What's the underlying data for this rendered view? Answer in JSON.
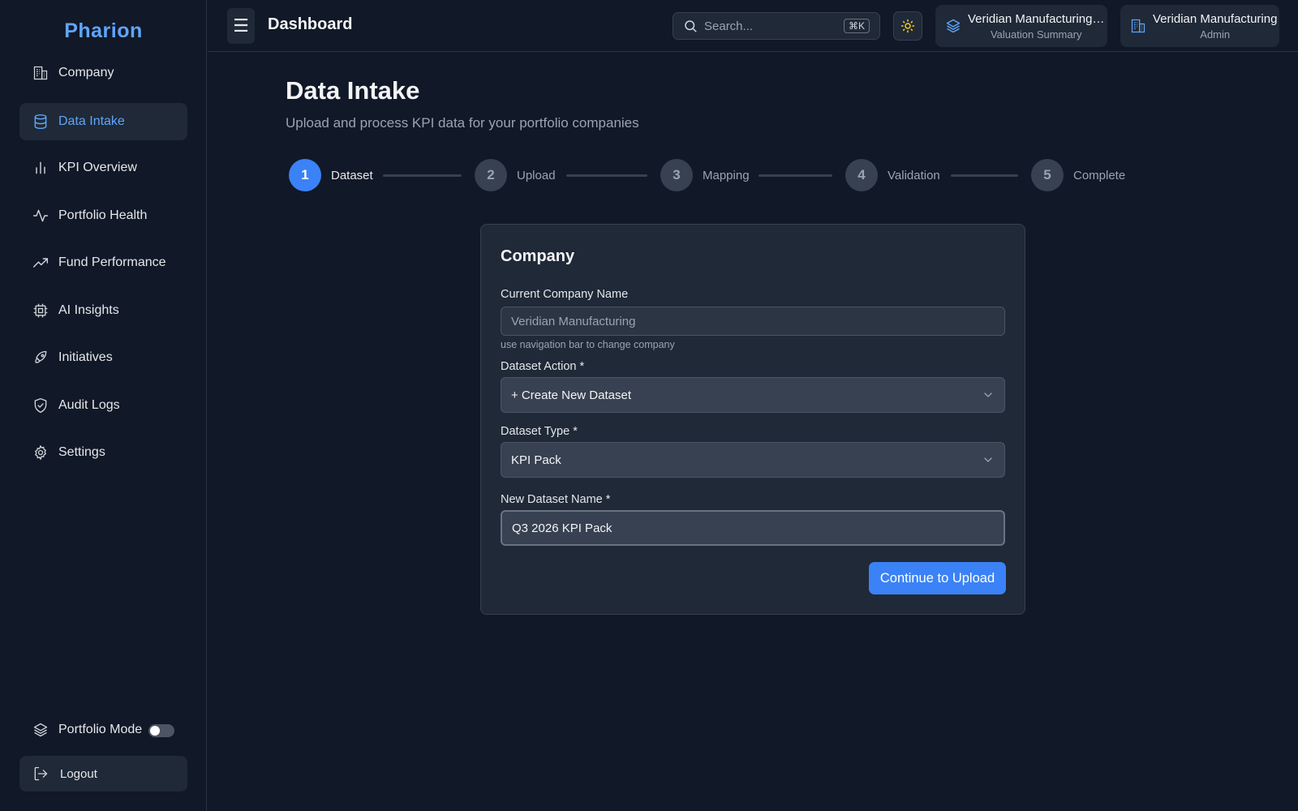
{
  "brand": "Pharion",
  "sidebar": {
    "items": [
      {
        "label": "Company",
        "icon": "building-icon"
      },
      {
        "label": "Data Intake",
        "icon": "database-icon",
        "active": true
      },
      {
        "label": "KPI Overview",
        "icon": "bar-chart-icon"
      },
      {
        "label": "Portfolio Health",
        "icon": "activity-icon"
      },
      {
        "label": "Fund Performance",
        "icon": "trending-up-icon"
      },
      {
        "label": "AI Insights",
        "icon": "cpu-icon"
      },
      {
        "label": "Initiatives",
        "icon": "rocket-icon"
      },
      {
        "label": "Audit Logs",
        "icon": "shield-check-icon"
      },
      {
        "label": "Settings",
        "icon": "gear-icon"
      }
    ],
    "portfolio_mode_label": "Portfolio Mode",
    "portfolio_mode_on": false,
    "logout_label": "Logout"
  },
  "header": {
    "menu_glyph": "☰",
    "title": "Dashboard",
    "search_placeholder": "Search...",
    "search_shortcut": "⌘K",
    "context_dataset": {
      "title": "Veridian Manufacturing…",
      "subtitle": "Valuation Summary"
    },
    "context_company": {
      "title": "Veridian Manufacturing",
      "subtitle": "Admin"
    }
  },
  "main": {
    "title": "Data Intake",
    "subtitle": "Upload and process KPI data for your portfolio companies",
    "steps": [
      {
        "number": "1",
        "label": "Dataset",
        "active": true
      },
      {
        "number": "2",
        "label": "Upload"
      },
      {
        "number": "3",
        "label": "Mapping"
      },
      {
        "number": "4",
        "label": "Validation"
      },
      {
        "number": "5",
        "label": "Complete"
      }
    ]
  },
  "form": {
    "title": "Company",
    "company_label": "Current Company Name",
    "company_value": "Veridian Manufacturing",
    "company_hint": "use navigation bar to change company",
    "action_label": "Dataset Action *",
    "action_value": "+ Create New Dataset",
    "type_label": "Dataset Type *",
    "type_value": "KPI Pack",
    "name_label": "New Dataset Name *",
    "name_value": "Q3 2026 KPI Pack",
    "continue_label": "Continue to Upload"
  },
  "colors": {
    "background": "#111827",
    "surface": "#1f2937",
    "accent": "#3b82f6",
    "accent_text": "#60a5fa",
    "sun": "#facc15"
  }
}
